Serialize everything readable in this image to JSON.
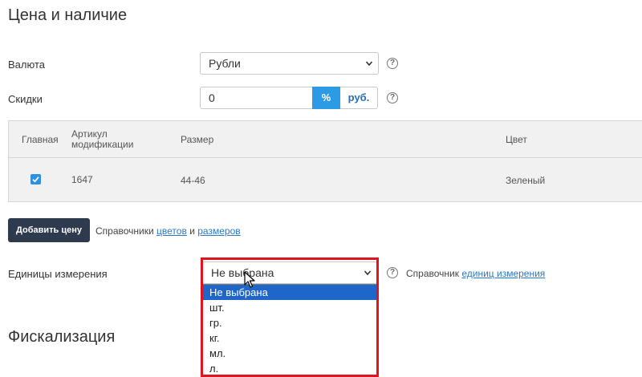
{
  "price_section": {
    "title": "Цена и наличие"
  },
  "currency": {
    "label": "Валюта",
    "value": "Рубли"
  },
  "discounts": {
    "label": "Скидки",
    "value": "0",
    "percent_label": "%",
    "rub_label": "руб."
  },
  "table": {
    "headers": [
      "Главная",
      "Артикул модификации",
      "Размер",
      "Цвет"
    ],
    "row": {
      "main_checked": true,
      "sku": "1647",
      "size": "44-46",
      "color": "Зеленый"
    }
  },
  "add_price_button": "Добавить цену",
  "references": {
    "prefix": "Справочники",
    "colors_link": "цветов",
    "middle": "и",
    "sizes_link": "размеров"
  },
  "units": {
    "label": "Единицы измерения",
    "value": "Не выбрана",
    "ref_prefix": "Справочник",
    "ref_link": "единиц измерения",
    "options": [
      "Не выбрана",
      "шт.",
      "гр.",
      "кг.",
      "мл.",
      "л."
    ]
  },
  "fiscal_section": {
    "title": "Фискализация"
  },
  "colors": {
    "accent": "#2d9ae6",
    "highlight": "#e0141e",
    "dark_button": "#2e3b4e"
  }
}
